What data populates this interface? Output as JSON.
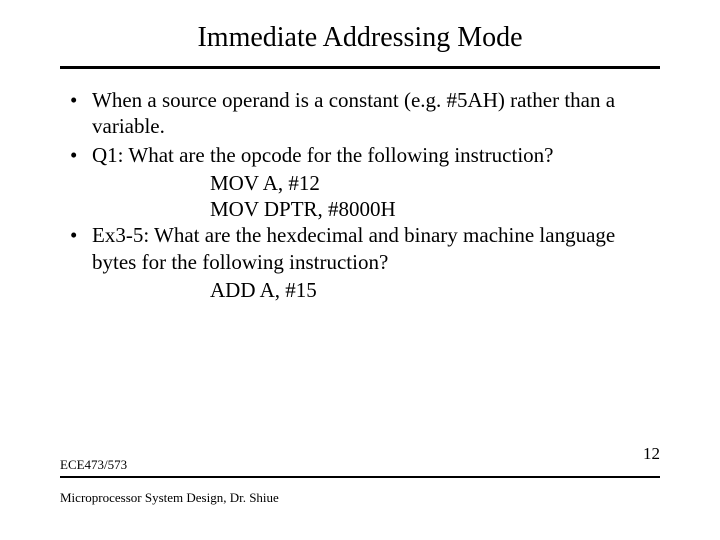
{
  "title": "Immediate Addressing Mode",
  "bullets": [
    {
      "text": "When a source operand is a constant (e.g. #5AH) rather than a variable."
    },
    {
      "text": "Q1: What are the opcode for the following instruction?"
    }
  ],
  "code1": [
    "MOV A, #12",
    "MOV DPTR, #8000H"
  ],
  "bullet3": {
    "text": "Ex3-5: What are the hexdecimal and binary machine language bytes for the following instruction?"
  },
  "code2": [
    "ADD A, #15"
  ],
  "footer": {
    "course": "ECE473/573",
    "subtitle": "Microprocessor System Design, Dr. Shiue",
    "page": "12"
  }
}
